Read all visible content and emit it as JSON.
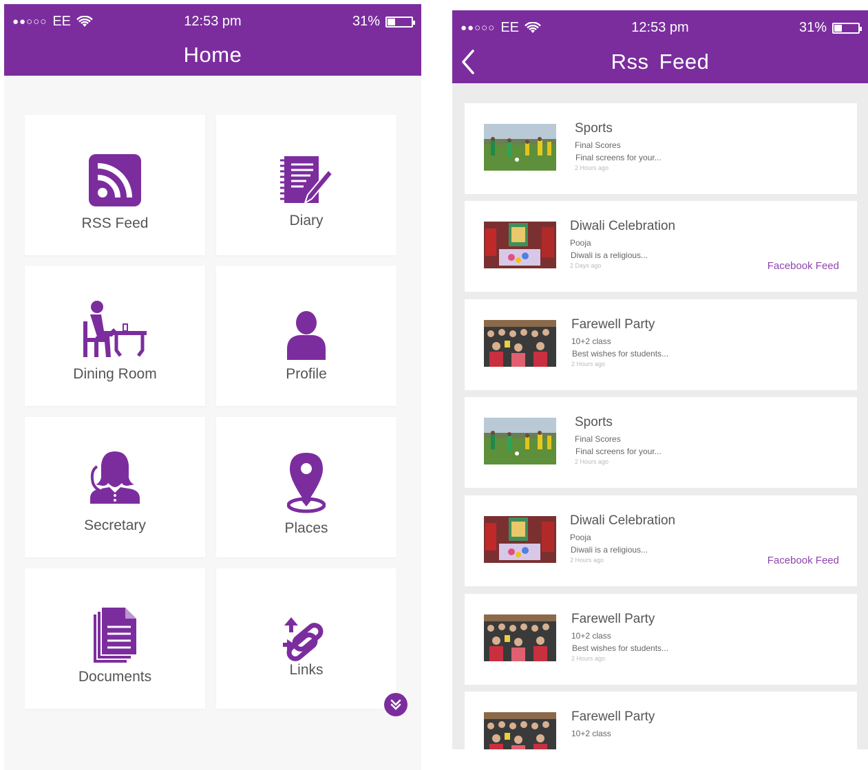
{
  "home": {
    "status": {
      "carrier": "EE",
      "signal_dots": "●●○○○",
      "time": "12:53 pm",
      "battery": "31%",
      "battery_level": 0.31
    },
    "title": "Home",
    "tiles": [
      {
        "label": "RSS Feed",
        "icon": "rss-icon"
      },
      {
        "label": "Diary",
        "icon": "diary-icon"
      },
      {
        "label": "Dining Room",
        "icon": "dining-room-icon"
      },
      {
        "label": "Profile",
        "icon": "profile-icon"
      },
      {
        "label": "Secretary",
        "icon": "secretary-icon"
      },
      {
        "label": "Places",
        "icon": "map-pin-icon"
      },
      {
        "label": "Documents",
        "icon": "documents-icon"
      },
      {
        "label": "Links",
        "icon": "links-icon"
      }
    ],
    "fab_icon": "chevron-double-down-icon"
  },
  "rss": {
    "status": {
      "carrier": "EE",
      "signal_dots": "●●○○○",
      "time": "12:53 pm",
      "battery": "31%",
      "battery_level": 0.31
    },
    "title": "Rss Feed",
    "back_icon": "chevron-left-icon",
    "items": [
      {
        "title": "Sports",
        "subtitle": "Final Scores",
        "desc": "Final screens for your...",
        "time": "2 Hours ago",
        "link": "",
        "image": "sports"
      },
      {
        "title": "Diwali Celebration",
        "subtitle": "Pooja",
        "desc": "Diwali is a religious...",
        "time": "2 Days ago",
        "link": "Facebook Feed",
        "image": "diwali"
      },
      {
        "title": "Farewell Party",
        "subtitle": "10+2 class",
        "desc": "Best wishes for students...",
        "time": "2 Hours ago",
        "link": "",
        "image": "farewell"
      },
      {
        "title": "Sports",
        "subtitle": "Final Scores",
        "desc": "Final screens for your...",
        "time": "2 Hours ago",
        "link": "",
        "image": "sports"
      },
      {
        "title": "Diwali Celebration",
        "subtitle": "Pooja",
        "desc": "Diwali is a religious...",
        "time": "2 Hours ago",
        "link": "Facebook Feed",
        "image": "diwali"
      },
      {
        "title": "Farewell Party",
        "subtitle": "10+2 class",
        "desc": "Best wishes for students...",
        "time": "2 Hours ago",
        "link": "",
        "image": "farewell"
      },
      {
        "title": "Farewell Party",
        "subtitle": "10+2 class",
        "desc": "",
        "time": "",
        "link": "",
        "image": "farewell"
      }
    ]
  },
  "colors": {
    "accent": "#7b2d9e",
    "link": "#8e44ad",
    "home_bg": "#f7f7f7",
    "feed_bg": "#ececec"
  }
}
